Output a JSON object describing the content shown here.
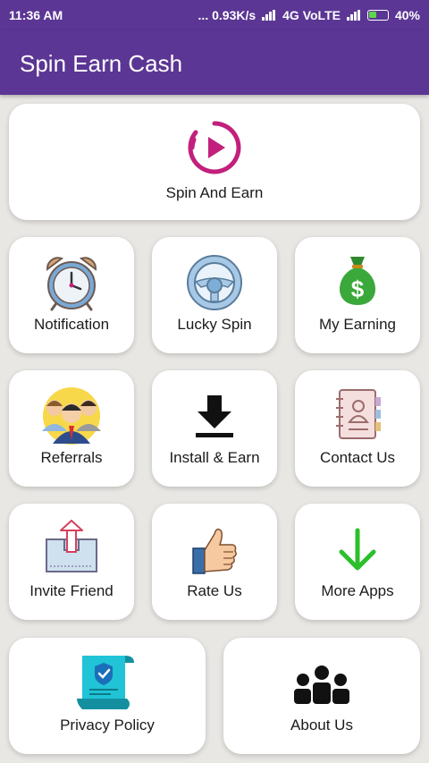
{
  "status": {
    "time": "11:36 AM",
    "speed": "... 0.93K/s",
    "network": "4G VoLTE",
    "battery": "40%"
  },
  "appbar": {
    "title": "Spin Earn Cash"
  },
  "cards": {
    "spin_and_earn": "Spin And Earn",
    "notification": "Notification",
    "lucky_spin": "Lucky Spin",
    "my_earning": "My Earning",
    "referrals": "Referrals",
    "install_earn": "Install & Earn",
    "contact_us": "Contact Us",
    "invite_friend": "Invite Friend",
    "rate_us": "Rate Us",
    "more_apps": "More Apps",
    "privacy_policy": "Privacy Policy",
    "about_us": "About Us"
  },
  "icons": {
    "spin": "play-circle-icon",
    "notification": "alarm-clock-icon",
    "lucky_spin": "steering-wheel-icon",
    "my_earning": "money-bag-icon",
    "referrals": "people-icon",
    "install": "download-icon",
    "contact": "address-book-icon",
    "invite": "share-box-icon",
    "rate": "thumbs-up-icon",
    "more_apps": "arrow-down-icon",
    "privacy": "policy-scroll-icon",
    "about": "group-icon"
  },
  "colors": {
    "primary": "#5b3694",
    "accent_pink": "#c2207c",
    "green": "#2bbf2b"
  }
}
